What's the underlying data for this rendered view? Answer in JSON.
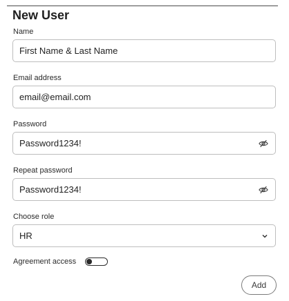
{
  "form": {
    "title": "New User",
    "name": {
      "label": "Name",
      "value": "First Name & Last Name"
    },
    "email": {
      "label": "Email address",
      "value": "email@email.com"
    },
    "password": {
      "label": "Password",
      "value": "Password1234!",
      "icon": "eye-off-icon"
    },
    "repeat_password": {
      "label": "Repeat password",
      "value": "Password1234!",
      "icon": "eye-off-icon"
    },
    "role": {
      "label": "Choose role",
      "value": "HR",
      "icon": "chevron-down-icon"
    },
    "agreement": {
      "label": "Agreement access",
      "toggle_on": false
    },
    "add_label": "Add"
  }
}
